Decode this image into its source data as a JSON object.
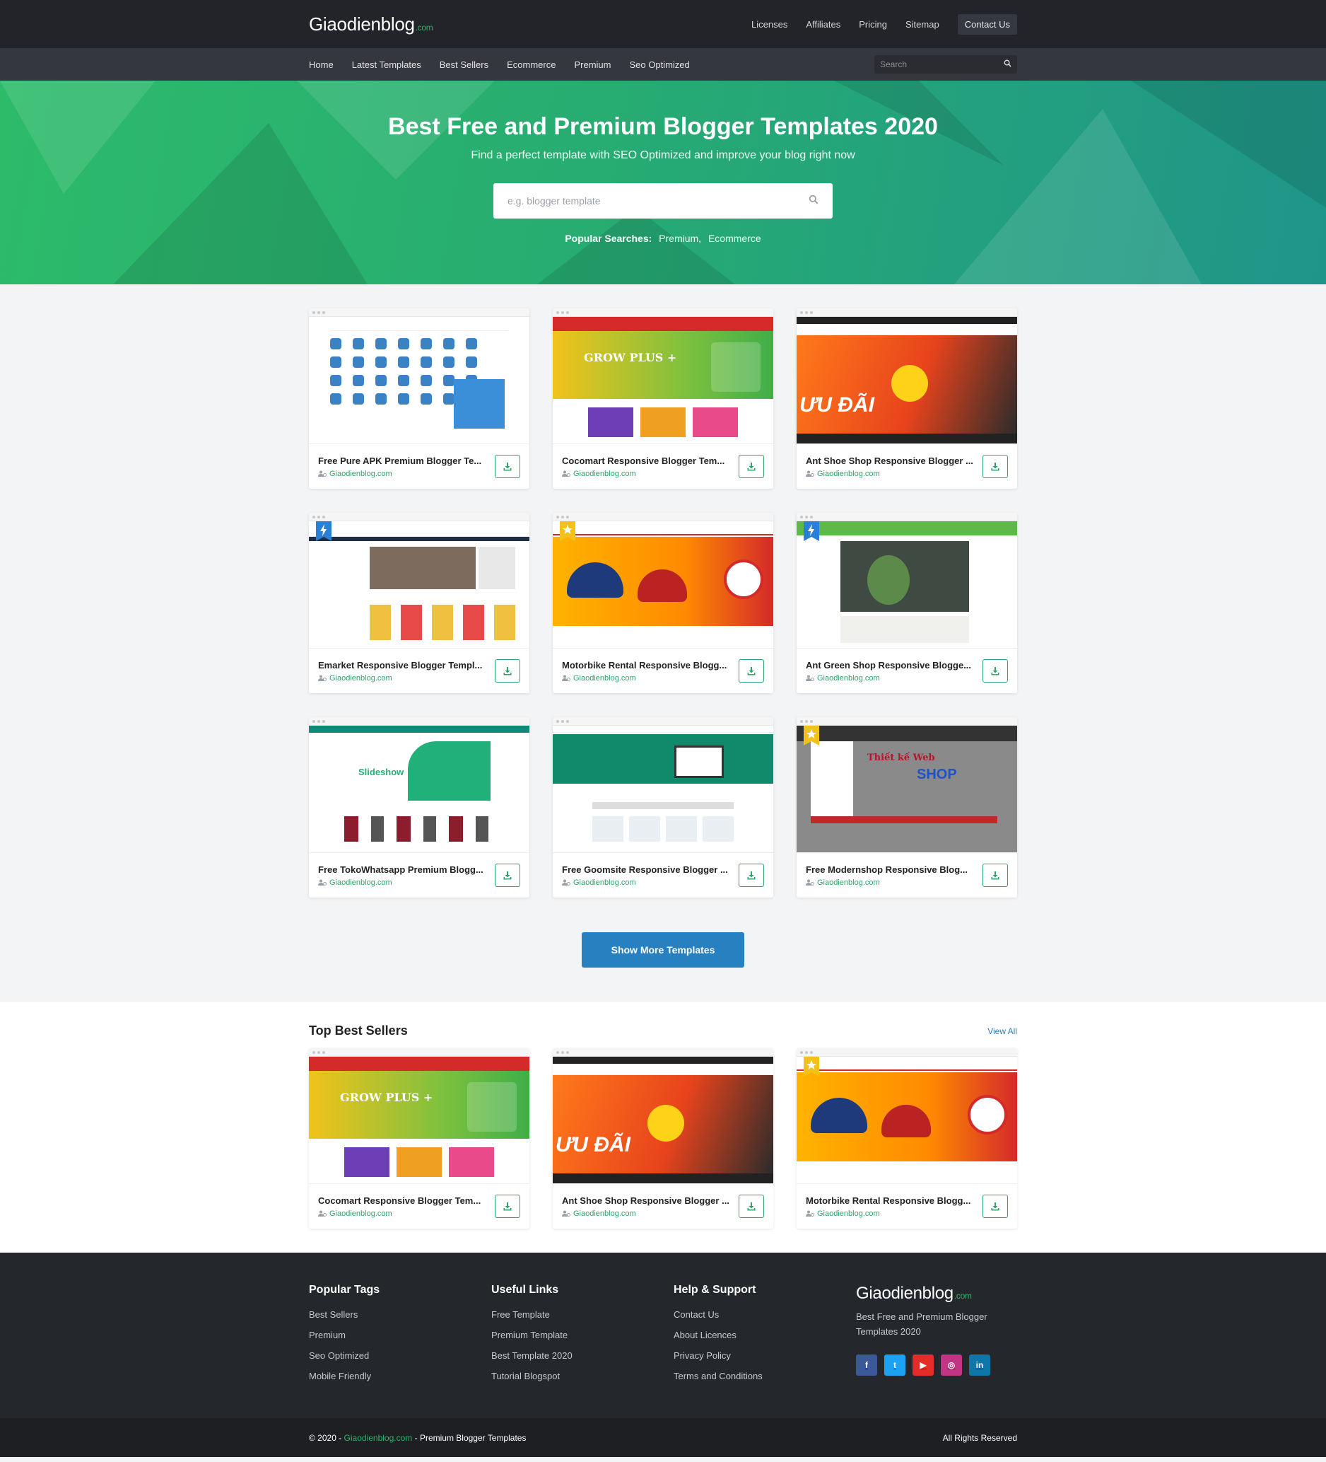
{
  "brand": {
    "name": "Giaodienblog",
    "tld": ".com"
  },
  "topnav": [
    "Licenses",
    "Affiliates",
    "Pricing",
    "Sitemap"
  ],
  "contact_label": "Contact Us",
  "subnav": [
    "Home",
    "Latest Templates",
    "Best Sellers",
    "Ecommerce",
    "Premium",
    "Seo Optimized"
  ],
  "nav_search_placeholder": "Search",
  "hero": {
    "title": "Best Free and Premium Blogger Templates 2020",
    "subtitle": "Find a perfect template with SEO Optimized and improve your blog right now",
    "search_placeholder": "e.g. blogger template",
    "popular_label": "Popular Searches:",
    "popular_items": [
      "Premium,",
      "Ecommerce"
    ]
  },
  "templates": [
    {
      "title": "Free Pure APK Premium Blogger Te...",
      "author": "Giaodienblog.com",
      "theme": "white-blue",
      "badge": ""
    },
    {
      "title": "Cocomart Responsive Blogger Tem...",
      "author": "Giaodienblog.com",
      "theme": "green-yellow",
      "badge": ""
    },
    {
      "title": "Ant Shoe Shop Responsive Blogger ...",
      "author": "Giaodienblog.com",
      "theme": "orange-dark",
      "badge": ""
    },
    {
      "title": "Emarket Responsive Blogger Templ...",
      "author": "Giaodienblog.com",
      "theme": "white-grey",
      "badge": "bolt"
    },
    {
      "title": "Motorbike Rental Responsive Blogg...",
      "author": "Giaodienblog.com",
      "theme": "orange-red",
      "badge": "star"
    },
    {
      "title": "Ant Green Shop Responsive Blogge...",
      "author": "Giaodienblog.com",
      "theme": "green-plant",
      "badge": "bolt"
    },
    {
      "title": "Free TokoWhatsapp Premium Blogg...",
      "author": "Giaodienblog.com",
      "theme": "teal-slide",
      "badge": ""
    },
    {
      "title": "Free Goomsite Responsive Blogger ...",
      "author": "Giaodienblog.com",
      "theme": "teal-site",
      "badge": ""
    },
    {
      "title": "Free Modernshop Responsive Blog...",
      "author": "Giaodienblog.com",
      "theme": "grey-shop",
      "badge": "star"
    }
  ],
  "show_more_label": "Show More Templates",
  "best": {
    "title": "Top Best Sellers",
    "view_all": "View All",
    "items": [
      {
        "title": "Cocomart Responsive Blogger Tem...",
        "author": "Giaodienblog.com",
        "theme": "green-yellow",
        "badge": ""
      },
      {
        "title": "Ant Shoe Shop Responsive Blogger ...",
        "author": "Giaodienblog.com",
        "theme": "orange-dark",
        "badge": ""
      },
      {
        "title": "Motorbike Rental Responsive Blogg...",
        "author": "Giaodienblog.com",
        "theme": "orange-red",
        "badge": "star"
      }
    ]
  },
  "footer": {
    "popular_tags": {
      "title": "Popular Tags",
      "links": [
        "Best Sellers",
        "Premium",
        "Seo Optimized",
        "Mobile Friendly"
      ]
    },
    "useful_links": {
      "title": "Useful Links",
      "links": [
        "Free Template",
        "Premium Template",
        "Best Template 2020",
        "Tutorial Blogspot"
      ]
    },
    "help": {
      "title": "Help & Support",
      "links": [
        "Contact Us",
        "About Licences",
        "Privacy Policy",
        "Terms and Conditions"
      ]
    },
    "tagline": "Best Free and Premium Blogger Templates 2020",
    "socials": [
      {
        "name": "facebook-icon",
        "color": "#3b5998",
        "glyph": "f"
      },
      {
        "name": "twitter-icon",
        "color": "#1da1f2",
        "glyph": "t"
      },
      {
        "name": "youtube-icon",
        "color": "#e52d27",
        "glyph": "▶"
      },
      {
        "name": "instagram-icon",
        "color": "#c13584",
        "glyph": "◎"
      },
      {
        "name": "linkedin-icon",
        "color": "#0e76a8",
        "glyph": "in"
      }
    ]
  },
  "bottom": {
    "copy_prefix": "© 2020 - ",
    "copy_brand": "Giaodienblog.com",
    "copy_suffix": " - Premium Blogger Templates",
    "rights": "All Rights Reserved"
  }
}
